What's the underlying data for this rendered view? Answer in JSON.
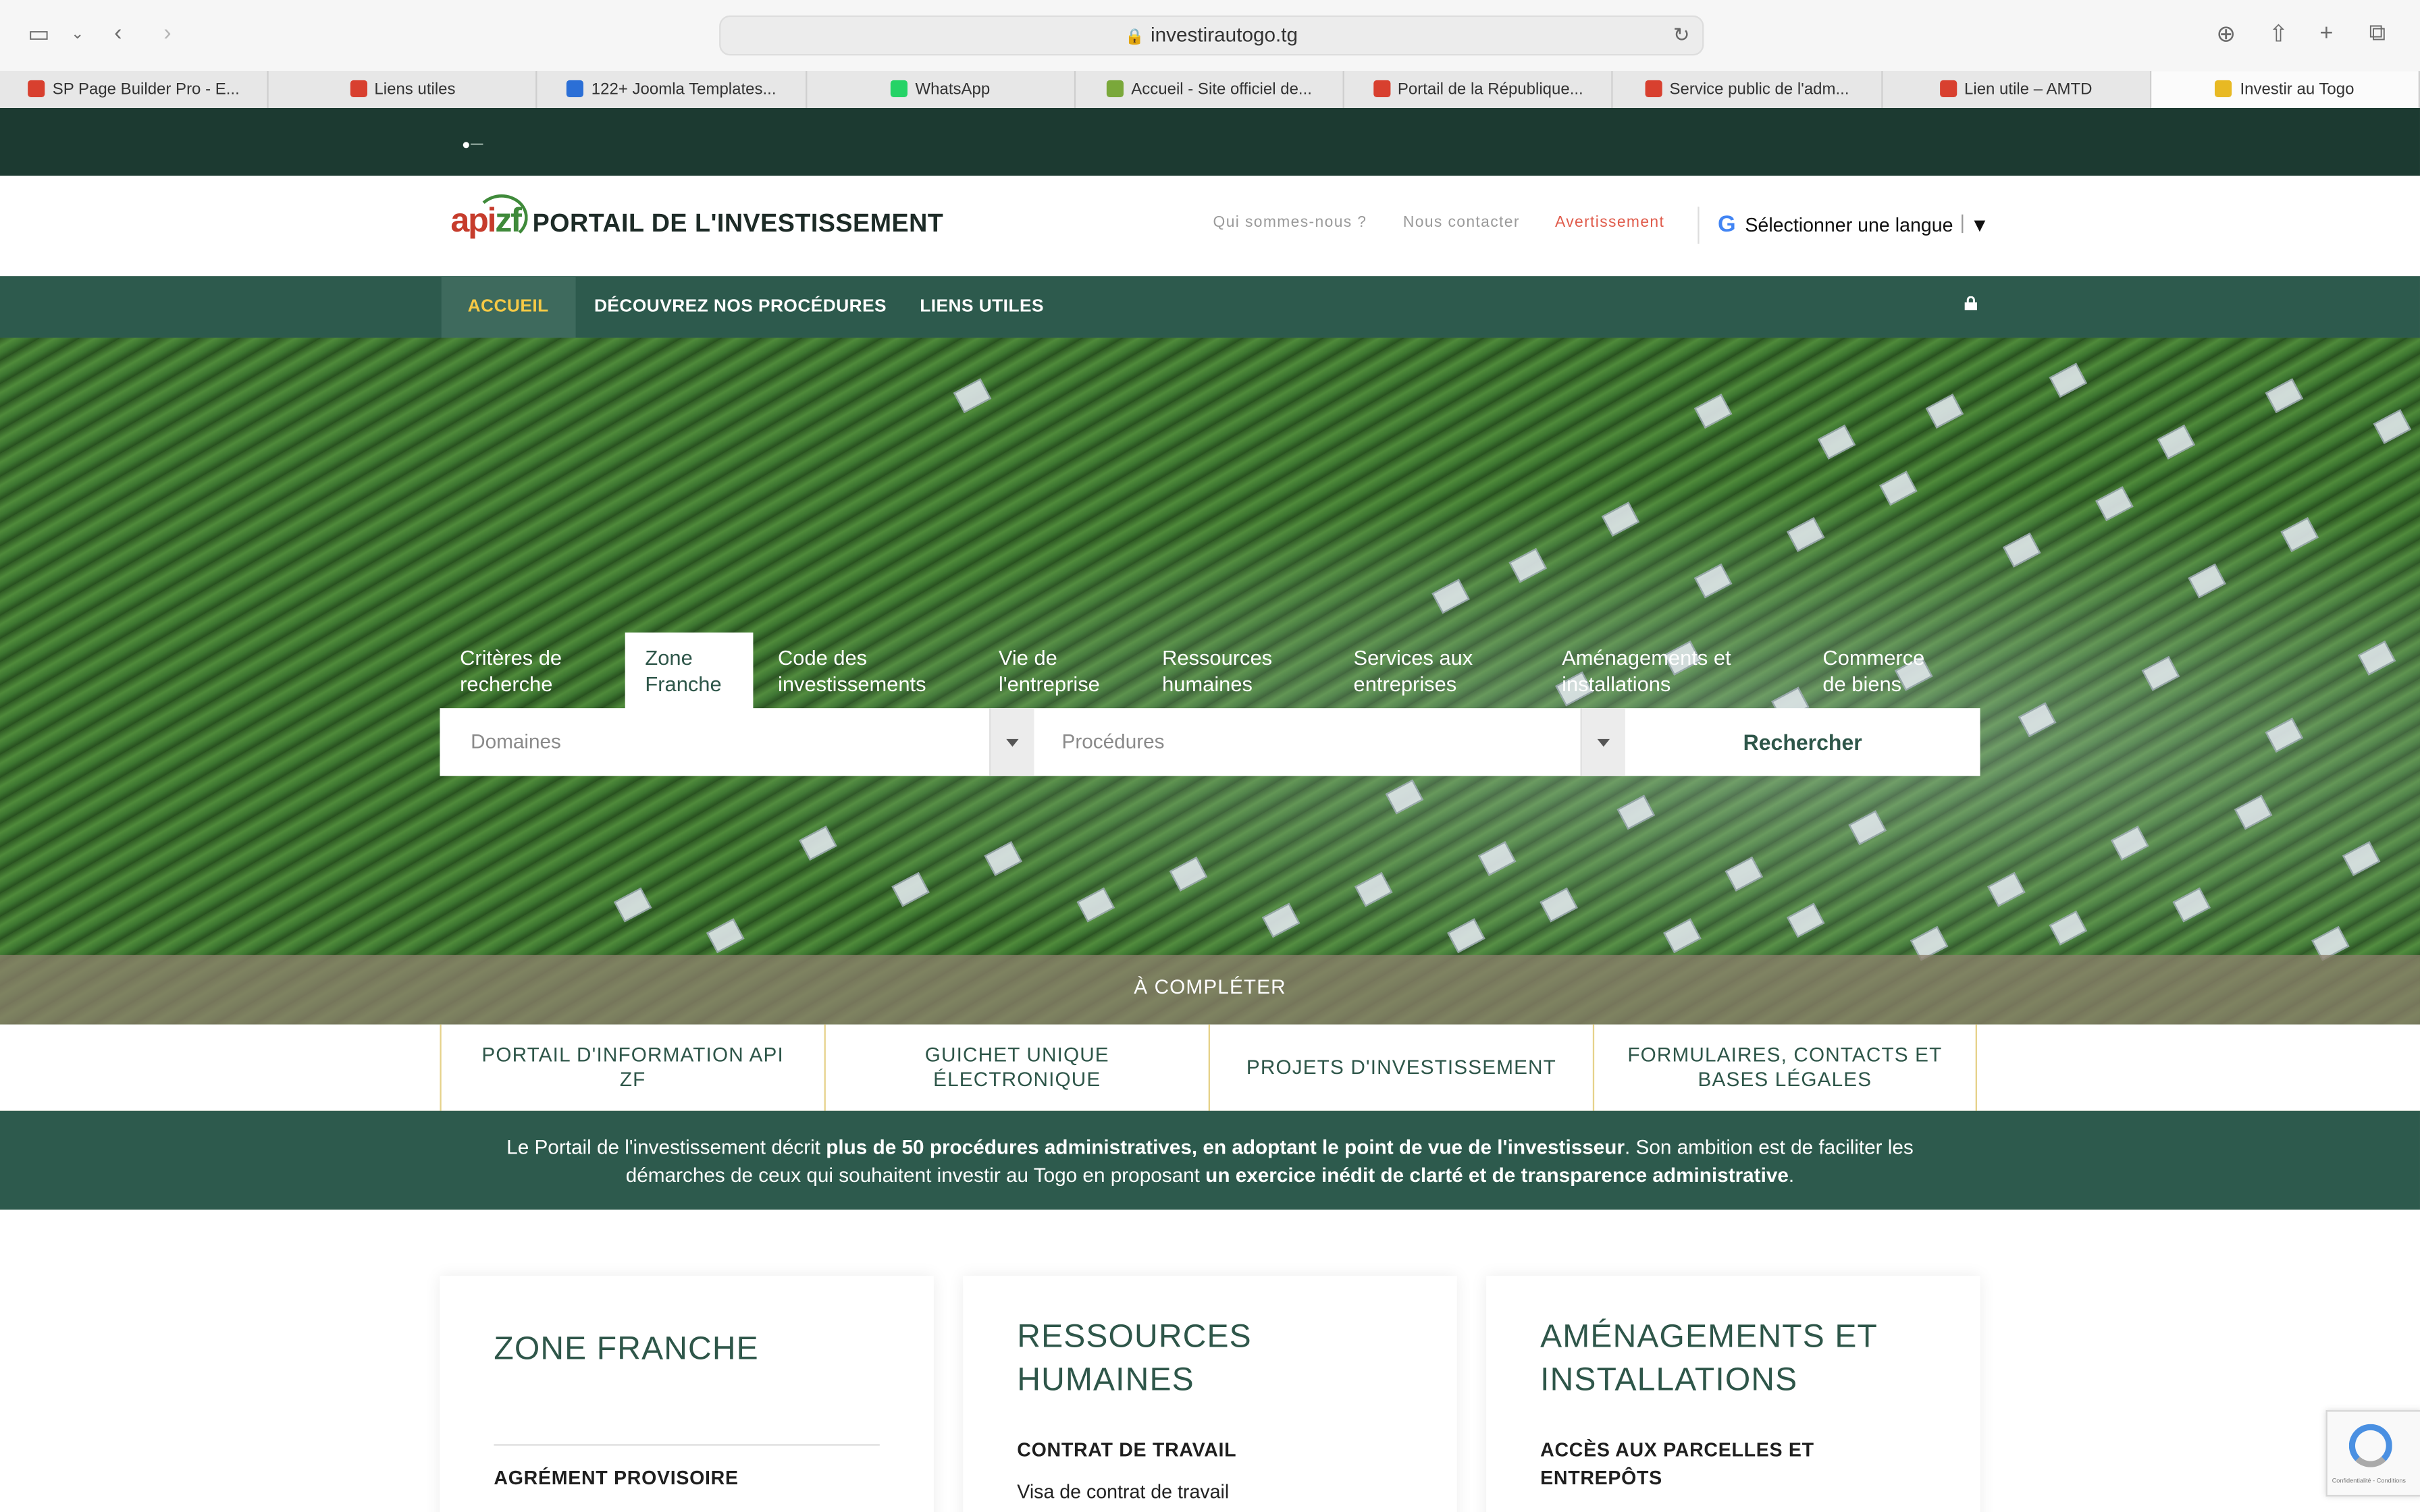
{
  "browser": {
    "url": "investirautogo.tg",
    "tabs": [
      {
        "label": "SP Page Builder Pro - E...",
        "favicon_color": "#d8402f"
      },
      {
        "label": "Liens utiles",
        "favicon_color": "#d8402f"
      },
      {
        "label": "122+ Joomla Templates...",
        "favicon_color": "#2b6fd6"
      },
      {
        "label": "WhatsApp",
        "favicon_color": "#25d366"
      },
      {
        "label": "Accueil - Site officiel de...",
        "favicon_color": "#7aa83a"
      },
      {
        "label": "Portail de la République...",
        "favicon_color": "#d8402f"
      },
      {
        "label": "Service public de l'adm...",
        "favicon_color": "#d8402f"
      },
      {
        "label": "Lien utile – AMTD",
        "favicon_color": "#d8402f"
      },
      {
        "label": "Investir au Togo",
        "favicon_color": "#e8b923"
      }
    ]
  },
  "header": {
    "logo_api": "api",
    "logo_zf": "zf",
    "title": "PORTAIL DE L'INVESTISSEMENT",
    "links": [
      "Qui sommes-nous ?",
      "Nous contacter",
      "Avertissement"
    ],
    "language": "Sélectionner une langue",
    "language_caret": "▼"
  },
  "nav": {
    "items": [
      "ACCUEIL",
      "DÉCOUVREZ NOS PROCÉDURES",
      "LIENS UTILES"
    ]
  },
  "search": {
    "tabs": [
      {
        "label": "Critères de recherche"
      },
      {
        "label": "Zone Franche"
      },
      {
        "label": "Code des investissements"
      },
      {
        "label": "Vie de l'entreprise"
      },
      {
        "label": "Ressources humaines"
      },
      {
        "label": "Services aux entreprises"
      },
      {
        "label": "Aménagements et installations"
      },
      {
        "label": "Commerce de biens"
      }
    ],
    "domains_placeholder": "Domaines",
    "procedures_placeholder": "Procédures",
    "button": "Rechercher"
  },
  "hero": {
    "caption": "À COMPLÉTER"
  },
  "quick_links": [
    "PORTAIL D'INFORMATION API ZF",
    "GUICHET UNIQUE ÉLECTRONIQUE",
    "PROJETS D'INVESTISSEMENT",
    "FORMULAIRES, CONTACTS ET BASES LÉGALES"
  ],
  "intro": {
    "p1": "Le Portail de l'investissement décrit ",
    "b1": "plus de 50 procédures administratives, en adoptant le point de vue de l'investisseur",
    "p2": ". Son ambition est de faciliter les démarches de ceux qui souhaitent investir au Togo en proposant ",
    "b2": "un exercice inédit de clarté et de transparence administrative",
    "p3": "."
  },
  "cards": [
    {
      "title": "ZONE FRANCHE",
      "subtitle": "AGRÉMENT PROVISOIRE",
      "link": ""
    },
    {
      "title": "RESSOURCES HUMAINES",
      "subtitle": "CONTRAT DE TRAVAIL",
      "link": "Visa de contrat de travail"
    },
    {
      "title": "AMÉNAGEMENTS ET INSTALLATIONS",
      "subtitle": "ACCÈS AUX PARCELLES ET ENTREPÔTS",
      "link": ""
    }
  ],
  "recaptcha": {
    "text": "Confidentialité - Conditions"
  },
  "colors": {
    "dark_green": "#1c3a31",
    "nav_green": "#2d5a4d",
    "accent_yellow": "#f6c945",
    "warn_red": "#e05b4b"
  }
}
